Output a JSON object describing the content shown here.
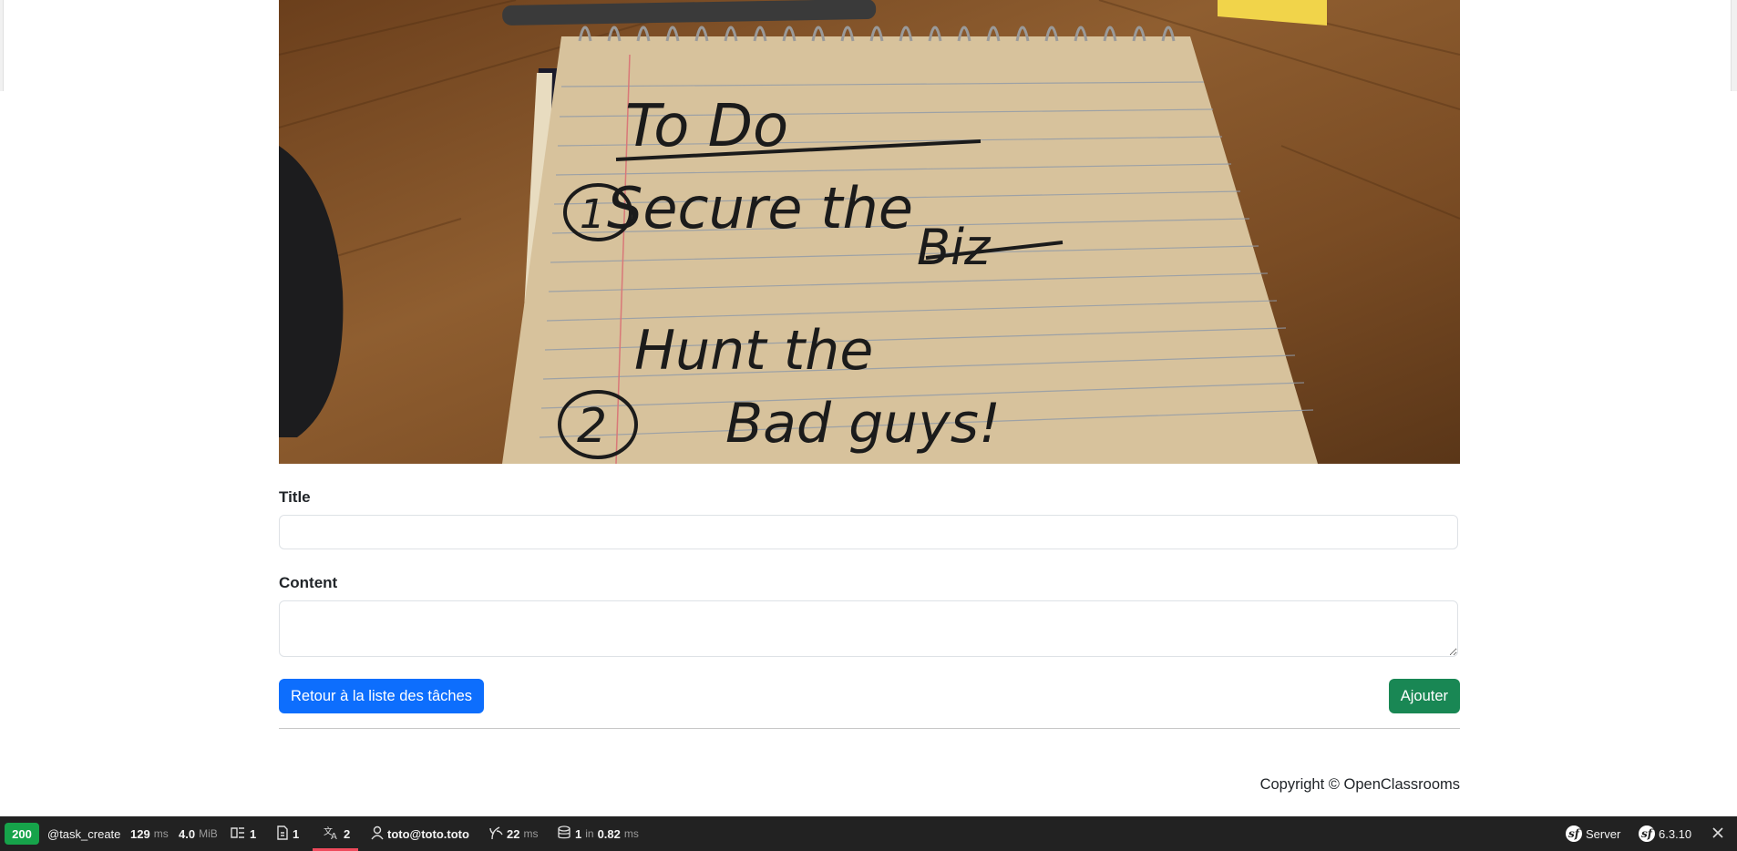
{
  "form": {
    "title_label": "Title",
    "title_value": "",
    "content_label": "Content",
    "content_value": ""
  },
  "actions": {
    "back_label": "Retour à la liste des tâches",
    "add_label": "Ajouter"
  },
  "footer": {
    "copyright": "Copyright © OpenClassrooms"
  },
  "hero_image": {
    "handwriting_lines": [
      "To Do",
      "Secure the",
      "Biz",
      "Hunt the",
      "Bad guys!"
    ],
    "numbers": [
      "1",
      "2"
    ]
  },
  "debug_toolbar": {
    "status_code": "200",
    "route": "@task_create",
    "time_value": "129",
    "time_unit": "ms",
    "memory_value": "4.0",
    "memory_unit": "MiB",
    "logs_count": "1",
    "forms_count": "1",
    "translations_count": "2",
    "user": "toto@toto.toto",
    "twig_value": "22",
    "twig_unit": "ms",
    "db_queries": "1",
    "db_in": "in",
    "db_time": "0.82",
    "db_unit": "ms",
    "server_label": "Server",
    "symfony_version": "6.3.10",
    "colors": {
      "bg": "#222222",
      "status_ok": "#16a34a",
      "active_tab": "#ef4a5b"
    }
  }
}
